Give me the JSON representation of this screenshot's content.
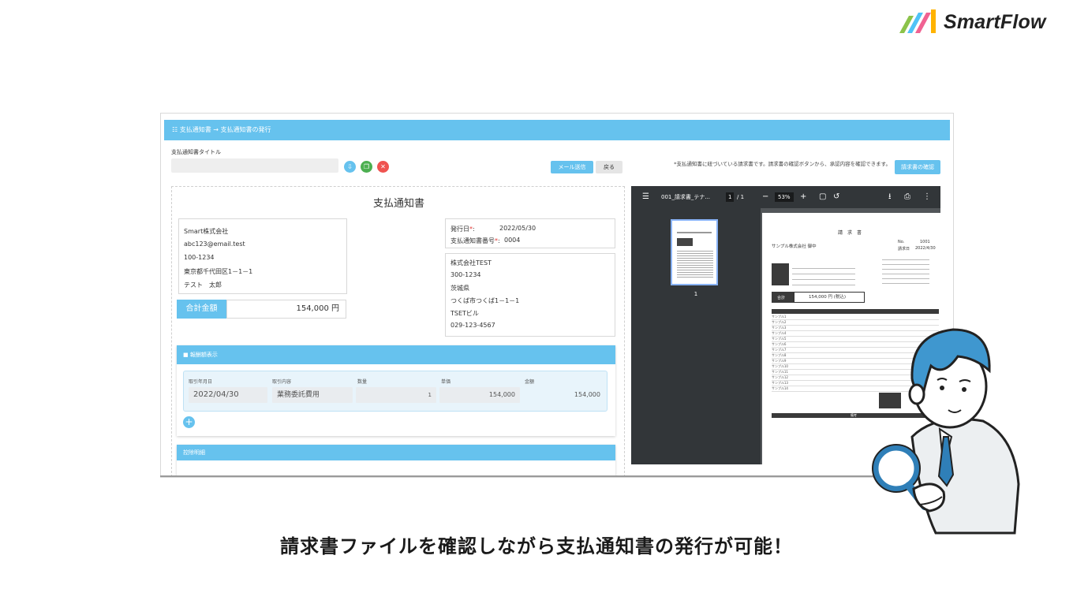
{
  "brand": {
    "name": "SmartFlow",
    "colors": [
      "#8bc34a",
      "#4fc3f7",
      "#f06292",
      "#ffb300"
    ]
  },
  "app": {
    "breadcrumb": "支払通知書 → 支払通知書の発行",
    "title_label": "支払通知書タイトル",
    "title_value": "",
    "icon_buttons": [
      {
        "name": "download-icon",
        "color": "#66c2ee",
        "glyph": "⇩"
      },
      {
        "name": "copy-icon",
        "color": "#4caf50",
        "glyph": "❐"
      },
      {
        "name": "trash-icon",
        "color": "#ef5350",
        "glyph": "✕"
      }
    ],
    "mail_button": "メール送信",
    "back_button": "戻る",
    "note": "*支払通知書に紐づいている請求書です。請求書の確認ボタンから、承認内容を確認できます。",
    "confirm_button": "請求書の確認"
  },
  "document": {
    "title": "支払通知書",
    "sender": [
      "Smart株式会社",
      "abc123@email.test",
      "100-1234",
      "東京都千代田区1－1－1",
      "テスト　太郎"
    ],
    "issue_date_label": "発行日",
    "issue_date": "2022/05/30",
    "number_label": "支払通知書番号",
    "number": "0004",
    "recipient": [
      "株式会社TEST",
      "300-1234",
      "茨城県",
      "つくば市つくば1－1－1",
      "TSETビル",
      "029-123-4567"
    ],
    "total_label": "合計金額",
    "total_value": "154,000 円"
  },
  "details": {
    "header": "報酬額表示",
    "columns": [
      "取引年月日",
      "取引内容",
      "数量",
      "単価",
      "金額"
    ],
    "row": {
      "date": "2022/04/30",
      "item": "業務委託費用",
      "qty": "1",
      "unit": "154,000",
      "amount": "154,000"
    },
    "add_glyph": "+"
  },
  "deduction": {
    "header": "控除明細"
  },
  "viewer": {
    "menu_glyph": "☰",
    "filename": "001_請求書_テナ...",
    "page_current": "1",
    "page_sep": "/ 1",
    "zoom": "53%",
    "minus": "−",
    "plus": "+",
    "thumb_number": "1",
    "page": {
      "title": "請　求　書",
      "to": "サンプル株式会社 御中",
      "no_label": "No.",
      "no_value": "1001",
      "date_label": "請求日",
      "date_value": "2022/4/30",
      "amount_label": "合計",
      "amount_value": "154,000 円 (税込)",
      "rows": [
        "サンプル1",
        "サンプル2",
        "サンプル3",
        "サンプル4",
        "サンプル5",
        "サンプル6",
        "サンプル7",
        "サンプル8",
        "サンプル9",
        "サンプル10",
        "サンプル11",
        "サンプル12",
        "サンプル13",
        "サンプル14"
      ],
      "footer": "備考"
    }
  },
  "caption": "請求書ファイルを確認しながら支払通知書の発行が可能！"
}
